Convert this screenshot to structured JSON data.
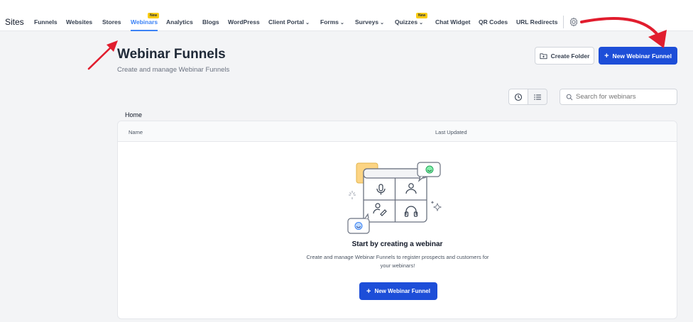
{
  "nav": {
    "brand": "Sites",
    "items": [
      {
        "label": "Funnels"
      },
      {
        "label": "Websites"
      },
      {
        "label": "Stores"
      },
      {
        "label": "Webinars",
        "badge": "New",
        "active": true
      },
      {
        "label": "Analytics"
      },
      {
        "label": "Blogs"
      },
      {
        "label": "WordPress"
      },
      {
        "label": "Client Portal"
      },
      {
        "label": "Forms"
      },
      {
        "label": "Surveys"
      },
      {
        "label": "Quizzes",
        "badge": "New"
      },
      {
        "label": "Chat Widget"
      },
      {
        "label": "QR Codes"
      },
      {
        "label": "URL Redirects"
      }
    ]
  },
  "header": {
    "title": "Webinar Funnels",
    "subtitle": "Create and manage Webinar Funnels",
    "create_folder_label": "Create Folder",
    "new_funnel_label": "New Webinar Funnel"
  },
  "search": {
    "placeholder": "Search for webinars"
  },
  "breadcrumb": "Home",
  "table": {
    "columns": [
      "Name",
      "Last Updated"
    ]
  },
  "empty_state": {
    "title": "Start by creating a webinar",
    "description": "Create and manage Webinar Funnels to register prospects and customers for your webinars!",
    "button_label": "New Webinar Funnel"
  },
  "colors": {
    "primary": "#1d4ed8",
    "active_nav": "#3b82f6",
    "badge": "#facc15",
    "annotation": "#e11d2e"
  },
  "icons": [
    "gear-icon",
    "folder-icon",
    "plus-icon",
    "clock-icon",
    "list-icon",
    "search-icon",
    "chevron-down-icon"
  ]
}
